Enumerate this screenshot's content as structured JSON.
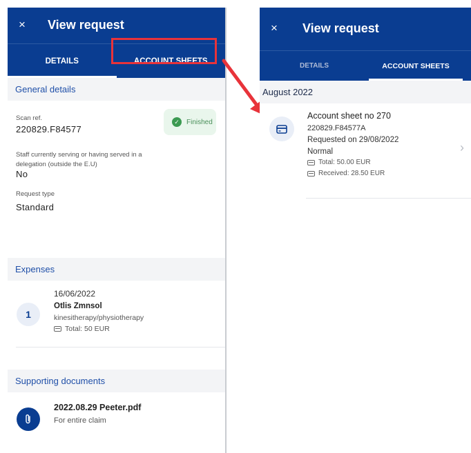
{
  "left": {
    "header": {
      "close_glyph": "×",
      "title": "View request"
    },
    "tabs": [
      {
        "label": "DETAILS",
        "active": true
      },
      {
        "label": "ACCOUNT SHEETS",
        "active": false
      }
    ],
    "general": {
      "heading": "General details",
      "scan_ref_label": "Scan ref.",
      "scan_ref_value": "220829.F84577",
      "status": "Finished",
      "staff_label_1": "Staff currently serving or having served in a",
      "staff_label_2": "delegation (outside the E.U)",
      "staff_value": "No",
      "request_type_label": "Request type",
      "request_type_value": "Standard"
    },
    "expenses": {
      "heading": "Expenses",
      "items": [
        {
          "index": "1",
          "date": "16/06/2022",
          "name": "Otlis Zmnsol",
          "type": "kinesitherapy/physiotherapy",
          "total": "Total: 50 EUR"
        }
      ]
    },
    "documents": {
      "heading": "Supporting documents",
      "items": [
        {
          "name": "2022.08.29 Peeter.pdf",
          "scope": "For entire claim"
        }
      ]
    }
  },
  "right": {
    "header": {
      "close_glyph": "×",
      "title": "View request"
    },
    "tabs": [
      {
        "label": "DETAILS",
        "active": false
      },
      {
        "label": "ACCOUNT SHEETS",
        "active": true
      }
    ],
    "month": "August 2022",
    "sheet": {
      "title": "Account sheet no 270",
      "ref": "220829.F84577A",
      "requested": "Requested on 29/08/2022",
      "priority": "Normal",
      "total": "Total: 50.00 EUR",
      "received": "Received: 28.50 EUR"
    }
  },
  "colors": {
    "primary": "#0a3d91",
    "highlight": "#e8333a",
    "success": "#3c9a52"
  }
}
